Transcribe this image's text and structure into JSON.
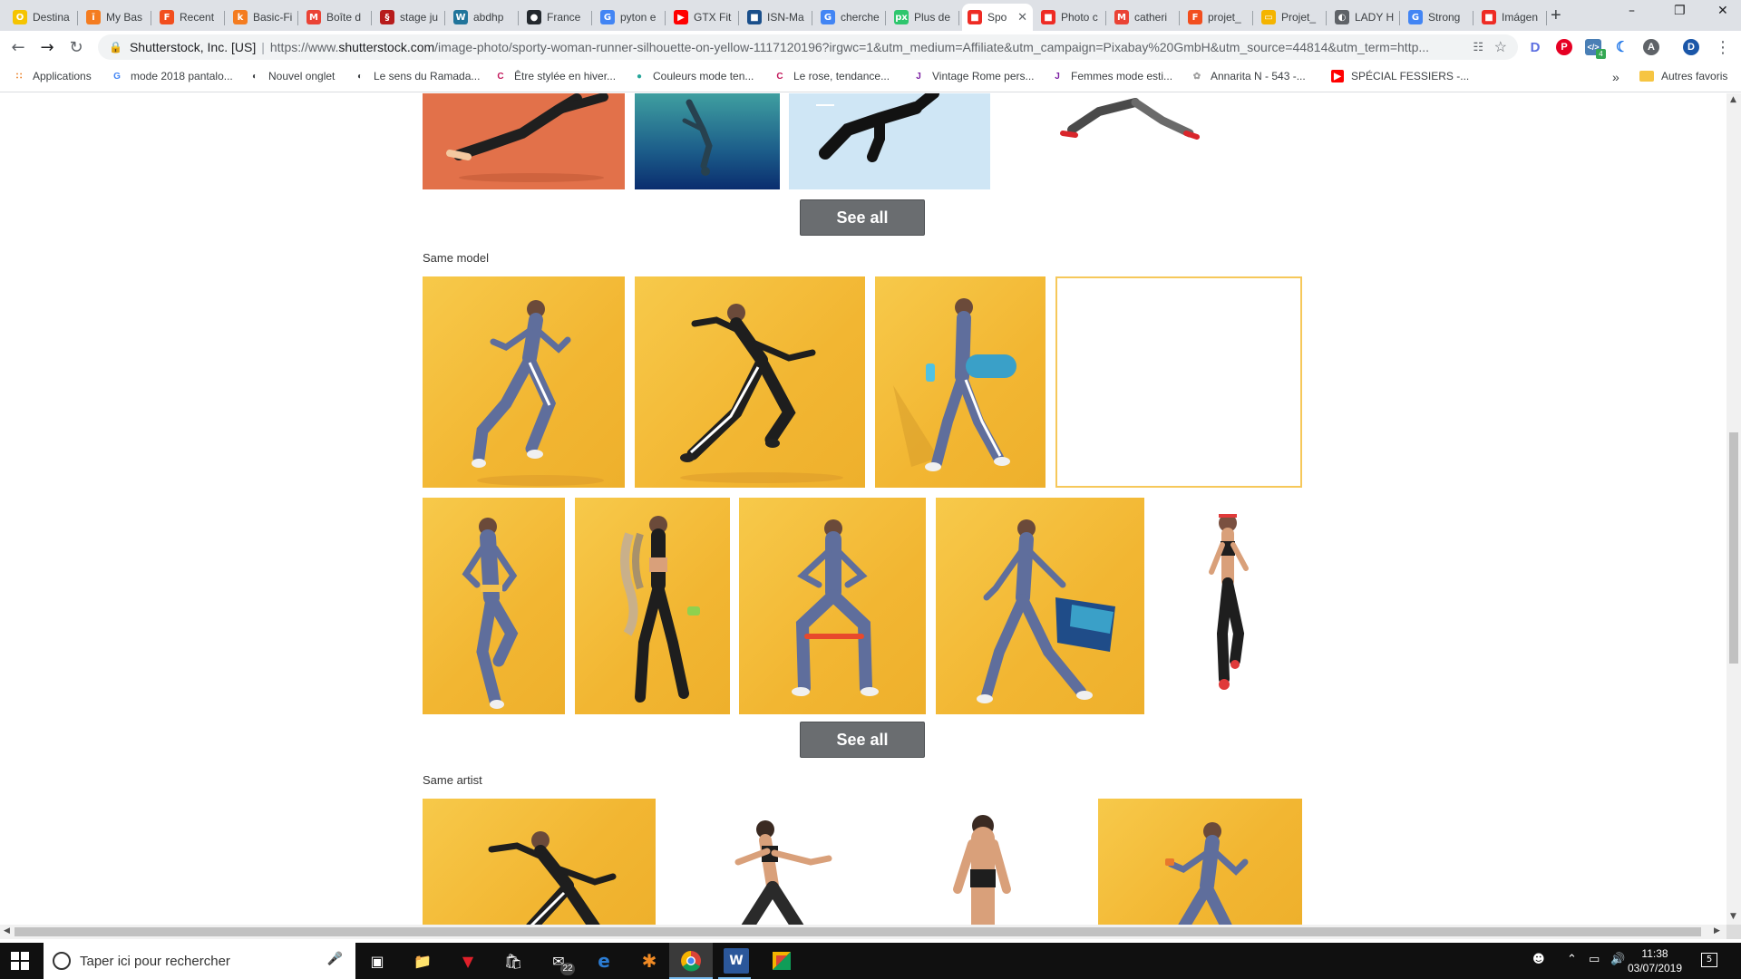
{
  "browser": {
    "tabs": [
      {
        "label": "Destina",
        "icon": "norton-icon",
        "color": "#f5c400",
        "glyph": "O"
      },
      {
        "label": "My Bas",
        "icon": "basic-fit-icon",
        "color": "#f47c20",
        "glyph": "ī"
      },
      {
        "label": "Recent",
        "icon": "figma-icon",
        "color": "#f24e1e",
        "glyph": "F"
      },
      {
        "label": "Basic-Fi",
        "icon": "basic-fit-icon",
        "color": "#f47c20",
        "glyph": "k"
      },
      {
        "label": "Boîte d",
        "icon": "gmail-icon",
        "color": "#ea4335",
        "glyph": "M"
      },
      {
        "label": "stage ju",
        "icon": "doc-icon",
        "color": "#b71c1c",
        "glyph": "§"
      },
      {
        "label": "abdhp",
        "icon": "wordpress-icon",
        "color": "#21759b",
        "glyph": "W"
      },
      {
        "label": "France",
        "icon": "github-icon",
        "color": "#24292e",
        "glyph": "●"
      },
      {
        "label": "pyton e",
        "icon": "google-icon",
        "color": "#4285f4",
        "glyph": "G"
      },
      {
        "label": "GTX Fit",
        "icon": "youtube-icon",
        "color": "#ff0000",
        "glyph": "▶"
      },
      {
        "label": "ISN-Ma",
        "icon": "isn-icon",
        "color": "#1a4f8b",
        "glyph": "■"
      },
      {
        "label": "cherche",
        "icon": "google-icon",
        "color": "#4285f4",
        "glyph": "G"
      },
      {
        "label": "Plus de",
        "icon": "pixabay-icon",
        "color": "#2ec66d",
        "glyph": "px"
      },
      {
        "label": "Spo",
        "icon": "shutterstock-icon",
        "color": "#ee2b24",
        "glyph": "■"
      },
      {
        "label": "Photo c",
        "icon": "shutterstock-icon",
        "color": "#ee2b24",
        "glyph": "■"
      },
      {
        "label": "catheri",
        "icon": "gmail-icon",
        "color": "#ea4335",
        "glyph": "M"
      },
      {
        "label": "projet_",
        "icon": "figma-icon",
        "color": "#f24e1e",
        "glyph": "F"
      },
      {
        "label": "Projet_",
        "icon": "slides-icon",
        "color": "#f4b400",
        "glyph": "▭"
      },
      {
        "label": "LADY H",
        "icon": "globe-icon",
        "color": "#5f6368",
        "glyph": "◐"
      },
      {
        "label": "Strong",
        "icon": "google-icon",
        "color": "#4285f4",
        "glyph": "G"
      },
      {
        "label": "Imágen",
        "icon": "shutterstock-icon",
        "color": "#ee2b24",
        "glyph": "■"
      }
    ],
    "active_tab_index": 13,
    "new_tab_label": "+",
    "address": {
      "site_name": "Shutterstock, Inc. [US]",
      "separator": "|",
      "url_prefix": "https://www.",
      "url_domain": "shutterstock.com",
      "url_rest": "/image-photo/sporty-woman-runner-silhouette-on-yellow-1117120196?irgwc=1&utm_medium=Affiliate&utm_campaign=Pixabay%20GmbH&utm_source=44814&utm_term=http..."
    },
    "profile_initial": "D",
    "extension_badge": "4",
    "bookmarks": [
      {
        "label": "Applications",
        "icon": "apps-grid-icon"
      },
      {
        "label": "mode 2018 pantalo...",
        "icon": "google-icon"
      },
      {
        "label": "Nouvel onglet",
        "icon": "globe-icon"
      },
      {
        "label": "Le sens du Ramada...",
        "icon": "globe-icon"
      },
      {
        "label": "Être stylée en hiver...",
        "icon": "c-icon"
      },
      {
        "label": "Couleurs mode ten...",
        "icon": "color-icon"
      },
      {
        "label": "Le rose, tendance...",
        "icon": "c-icon"
      },
      {
        "label": "Vintage Rome pers...",
        "icon": "j-icon"
      },
      {
        "label": "Femmes mode esti...",
        "icon": "j-icon"
      },
      {
        "label": "Annarita N - 543 -...",
        "icon": "pinwheel-icon"
      },
      {
        "label": "SPÉCIAL FESSIERS -...",
        "icon": "youtube-icon"
      }
    ],
    "bookmarks_overflow": "»",
    "other_bookmarks": "Autres favoris"
  },
  "page": {
    "see_all_label": "See all",
    "same_model_title": "Same model",
    "same_artist_title": "Same artist"
  },
  "taskbar": {
    "search_placeholder": "Taper ici pour rechercher",
    "mail_badge": "22",
    "time": "11:38",
    "date": "03/07/2019",
    "notification_count": "5"
  },
  "colors": {
    "brand_yellow": "#f2b632",
    "button_gray": "#6a6d70",
    "orange_thumb": "#e2714a",
    "light_blue_thumb": "#cfe6f5"
  }
}
